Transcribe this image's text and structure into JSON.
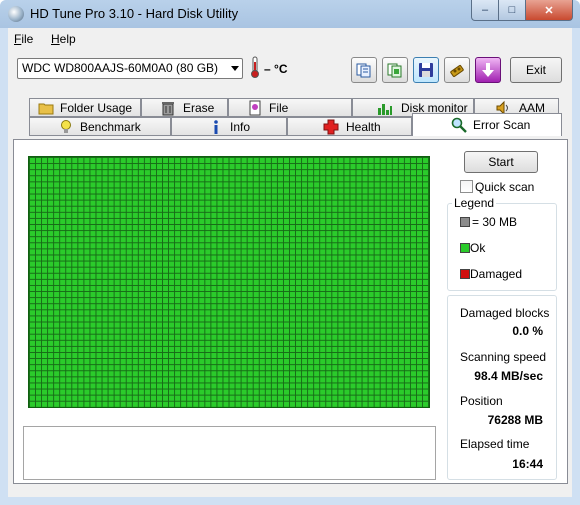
{
  "window": {
    "title": "HD Tune Pro 3.10 - Hard Disk Utility",
    "controls": {
      "min": "–",
      "max": "□",
      "close": "✕"
    }
  },
  "menu": {
    "file_mnemonic": "F",
    "file_rest": "ile",
    "help_mnemonic": "H",
    "help_rest": "elp"
  },
  "toolbar": {
    "drive": "WDC WD800AAJS-60M0A0 (80 GB)",
    "temperature_dash": "–",
    "temperature_unit": "°C",
    "exit_label": "Exit"
  },
  "tabs_row1": [
    {
      "label": "Folder Usage",
      "icon": "folder-icon"
    },
    {
      "label": "Erase",
      "icon": "trash-icon"
    },
    {
      "label": "File Benchmark",
      "icon": "file-benchmark-icon"
    },
    {
      "label": "Disk monitor",
      "icon": "disk-monitor-icon"
    },
    {
      "label": "AAM",
      "icon": "speaker-icon"
    }
  ],
  "tabs_row2": [
    {
      "label": "Benchmark",
      "icon": "lightbulb-icon"
    },
    {
      "label": "Info",
      "icon": "info-icon"
    },
    {
      "label": "Health",
      "icon": "health-cross-icon"
    },
    {
      "label": "Error Scan",
      "icon": "magnifier-icon",
      "selected": true
    }
  ],
  "scan": {
    "start_label": "Start",
    "quick_scan_label": "Quick scan",
    "quick_scan_checked": false,
    "block_state": "all-ok"
  },
  "legend": {
    "title": "Legend",
    "block_size": "= 30 MB",
    "ok": "Ok",
    "damaged": "Damaged",
    "colors": {
      "block": "#8c8c8c",
      "ok": "#2bcb2b",
      "damaged": "#d01010"
    }
  },
  "stats": {
    "damaged_blocks_label": "Damaged blocks",
    "damaged_blocks_value": "0.0 %",
    "scanning_speed_label": "Scanning speed",
    "scanning_speed_value": "98.4 MB/sec",
    "position_label": "Position",
    "position_value": "76288 MB",
    "elapsed_label": "Elapsed time",
    "elapsed_value": "16:44"
  }
}
